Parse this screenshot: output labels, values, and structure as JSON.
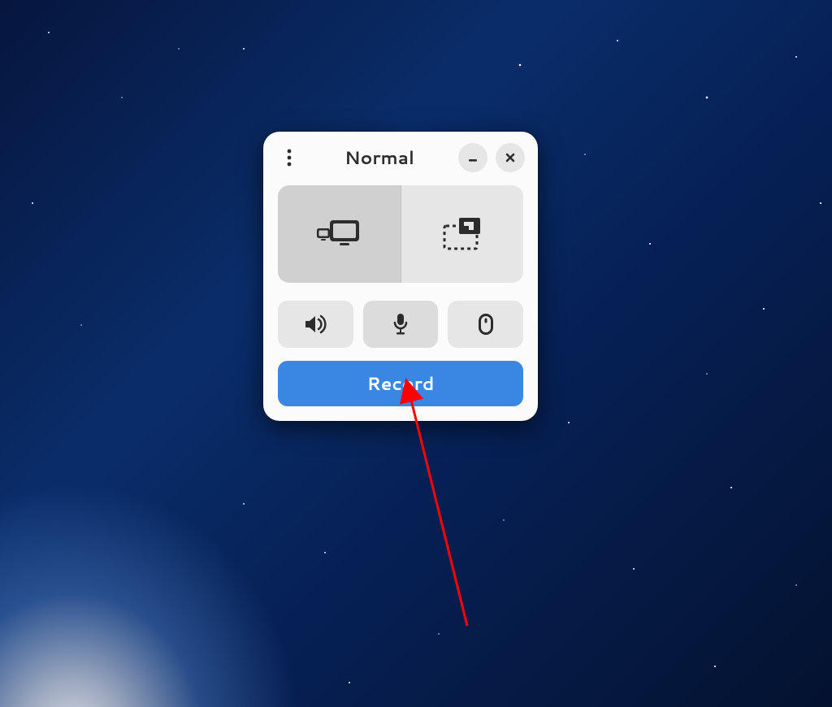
{
  "window": {
    "title": "Normal",
    "menu_icon": "kebab-menu-icon",
    "minimize_icon": "minimize-icon",
    "close_icon": "close-icon"
  },
  "modes": {
    "screen": {
      "icon": "screen-icon",
      "selected": true
    },
    "region": {
      "icon": "selection-icon",
      "selected": false
    }
  },
  "toggles": {
    "speaker": {
      "icon": "speaker-icon"
    },
    "microphone": {
      "icon": "microphone-icon"
    },
    "cursor": {
      "icon": "mouse-icon"
    }
  },
  "record_button_label": "Record",
  "annotation": {
    "type": "arrow",
    "color": "#ff0000",
    "target": "microphone-toggle"
  },
  "colors": {
    "accent": "#3a87e2",
    "window_bg": "#fbfbfb",
    "button_bg": "#e6e6e6"
  }
}
